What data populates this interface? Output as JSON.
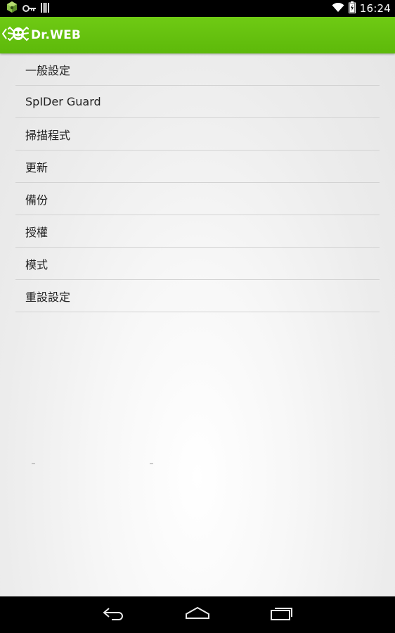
{
  "status_bar": {
    "time": "16:24",
    "left_icons": [
      "app-notification-icon",
      "key-icon",
      "barcode-icon"
    ],
    "right_icons": [
      "wifi-icon",
      "battery-charging-icon"
    ]
  },
  "action_bar": {
    "app_title": "Dr.WEB",
    "brand_color": "#66c20f",
    "icons": [
      "back-chevron-icon",
      "drweb-spider-logo-icon"
    ]
  },
  "settings": {
    "items": [
      {
        "label": "一般設定"
      },
      {
        "label": "SpIDer Guard"
      },
      {
        "label": "掃描程式"
      },
      {
        "label": "更新"
      },
      {
        "label": "備份"
      },
      {
        "label": "授權"
      },
      {
        "label": "模式"
      },
      {
        "label": "重設設定"
      }
    ]
  },
  "nav_bar": {
    "icons": [
      "back-icon",
      "home-icon",
      "recent-apps-icon"
    ]
  }
}
